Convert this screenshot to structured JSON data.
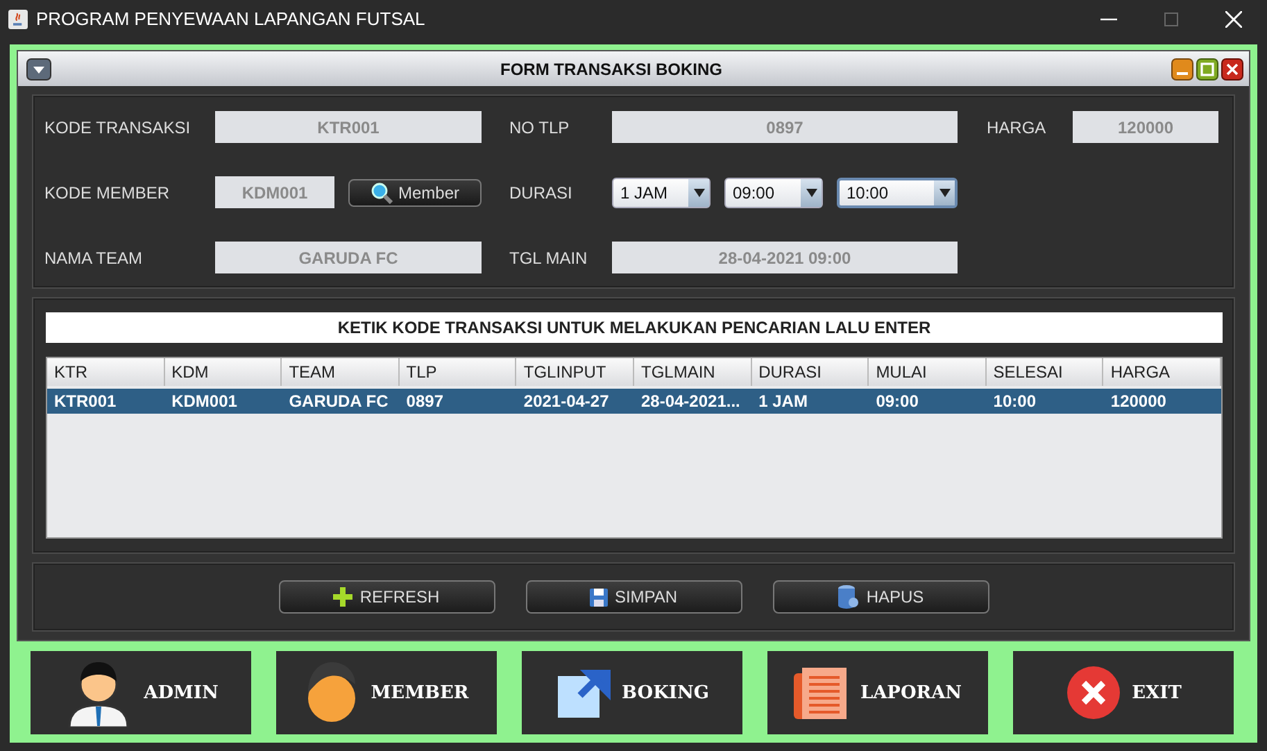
{
  "window": {
    "title": "PROGRAM PENYEWAAN LAPANGAN FUTSAL"
  },
  "frame": {
    "title": "FORM TRANSAKSI BOKING"
  },
  "form": {
    "rows": [
      [
        {
          "label": "KODE TRANSAKSI",
          "controls": [
            {
              "kind": "text",
              "value": "KTR001"
            }
          ]
        },
        {
          "label": "NO TLP",
          "controls": [
            {
              "kind": "text",
              "value": "0897"
            }
          ]
        },
        {
          "label": "HARGA",
          "controls": [
            {
              "kind": "text",
              "value": "120000"
            }
          ]
        }
      ],
      [
        {
          "label": "KODE MEMBER",
          "controls": [
            {
              "kind": "text",
              "value": "KDM001"
            },
            {
              "kind": "button",
              "value": "Member"
            }
          ]
        },
        {
          "label": "DURASI",
          "controls": [
            {
              "kind": "combo",
              "value": "1 JAM",
              "focused": false
            },
            {
              "kind": "combo",
              "value": "09:00",
              "focused": false
            },
            {
              "kind": "combo",
              "value": "10:00",
              "focused": true
            }
          ]
        }
      ],
      [
        {
          "label": "NAMA TEAM",
          "controls": [
            {
              "kind": "text",
              "value": "GARUDA FC"
            }
          ]
        },
        {
          "label": "TGL MAIN",
          "controls": [
            {
              "kind": "text",
              "value": "28-04-2021 09:00"
            }
          ]
        }
      ]
    ]
  },
  "search": {
    "value": "KETIK KODE TRANSAKSI UNTUK MELAKUKAN PENCARIAN LALU ENTER"
  },
  "table": {
    "columns": [
      "KTR",
      "KDM",
      "TEAM",
      "TLP",
      "TGLINPUT",
      "TGLMAIN",
      "DURASI",
      "MULAI",
      "SELESAI",
      "HARGA"
    ],
    "rows": [
      {
        "selected": true,
        "cells": [
          "KTR001",
          "KDM001",
          "GARUDA FC",
          "0897",
          "2021-04-27",
          "28-04-2021...",
          "1 JAM",
          "09:00",
          "10:00",
          "120000"
        ]
      }
    ]
  },
  "actions": [
    {
      "kind": "plus",
      "label": "REFRESH"
    },
    {
      "kind": "disk",
      "label": "SIMPAN"
    },
    {
      "kind": "database",
      "label": "HAPUS"
    }
  ],
  "nav": [
    {
      "kind": "admin",
      "label": "ADMIN"
    },
    {
      "kind": "member",
      "label": "MEMBER"
    },
    {
      "kind": "boking",
      "label": "BOKING"
    },
    {
      "kind": "laporan",
      "label": "LAPORAN"
    },
    {
      "kind": "exit",
      "label": "EXIT"
    }
  ]
}
